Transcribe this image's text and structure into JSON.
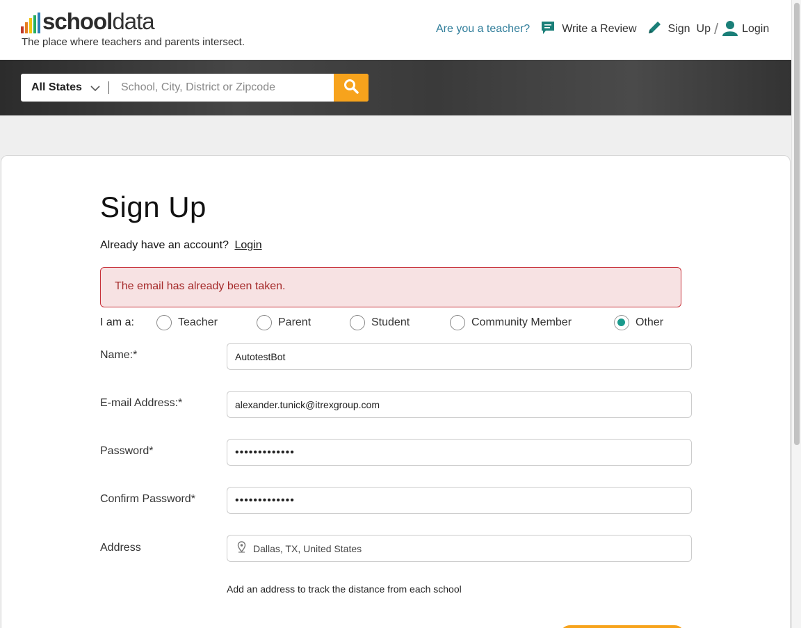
{
  "logo": {
    "bold": "school",
    "light": "data",
    "tagline": "The place where teachers and parents intersect."
  },
  "colors": {
    "accent": "#f7a31c",
    "teal": "#1a9a8c",
    "error_text": "#a52a2a",
    "link_blue": "#2f7d9a"
  },
  "topnav": {
    "teacher_link": "Are you a teacher?",
    "write_review": "Write a Review",
    "sign_up_a": "Sign",
    "sign_up_b": "Up",
    "separator": "/",
    "login": "Login",
    "icons": [
      "speech-bubble-icon",
      "pencil-icon",
      "user-icon"
    ]
  },
  "search": {
    "state_value": "All States",
    "placeholder": "School, City, District or Zipcode",
    "button_icon": "search-icon"
  },
  "form": {
    "title": "Sign Up",
    "already_text": "Already have an account?",
    "login_link": "Login",
    "error": "The email has already been taken.",
    "iam_label": "I am a:",
    "roles": [
      "Teacher",
      "Parent",
      "Student",
      "Community Member",
      "Other"
    ],
    "selected_role": "Other",
    "name_label": "Name:*",
    "name_value": "AutotestBot",
    "email_label": "E-mail Address:*",
    "email_value": "alexander.tunick@itrexgroup.com",
    "password_label": "Password*",
    "password_value": "•••••••••••••",
    "confirm_label": "Confirm Password*",
    "confirm_value": "•••••••••••••",
    "address_label": "Address",
    "address_value": "Dallas, TX, United States",
    "address_hint": "Add an address to track the distance from each school"
  }
}
